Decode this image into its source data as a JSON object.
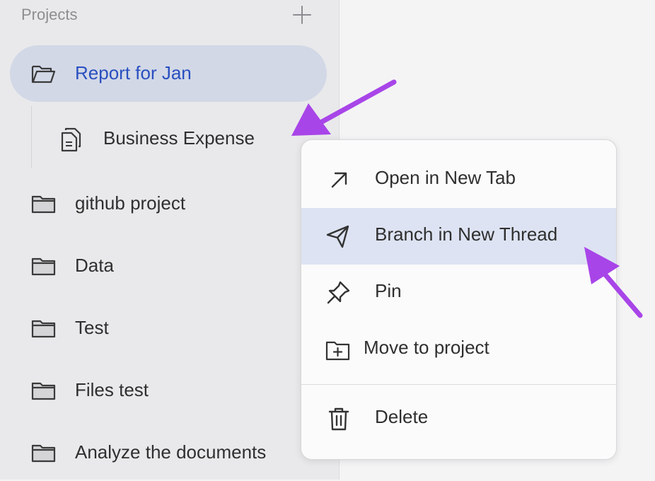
{
  "sidebar": {
    "section_title": "Projects",
    "add_icon": "plus-icon",
    "active_project": {
      "label": "Report for Jan",
      "icon": "folder-open-icon",
      "threads": [
        {
          "label": "Business Expense",
          "icon": "document-icon"
        }
      ]
    },
    "projects": [
      {
        "label": "github project",
        "icon": "folder-icon"
      },
      {
        "label": "Data",
        "icon": "folder-icon"
      },
      {
        "label": "Test",
        "icon": "folder-icon"
      },
      {
        "label": "Files test",
        "icon": "folder-icon"
      },
      {
        "label": "Analyze the documents",
        "icon": "folder-icon"
      }
    ]
  },
  "context_menu": {
    "items": [
      {
        "label": "Open in New Tab",
        "icon": "arrow-up-right-icon"
      },
      {
        "label": "Branch in New Thread",
        "icon": "send-icon",
        "highlighted": true
      },
      {
        "label": "Pin",
        "icon": "pin-icon"
      },
      {
        "label": "Move to project",
        "icon": "folder-plus-icon"
      },
      {
        "label": "Delete",
        "icon": "trash-icon"
      }
    ]
  },
  "colors": {
    "sidebar_bg": "#e9e9eb",
    "active_row_bg": "#d2d8e6",
    "active_text": "#2a4fc0",
    "menu_highlight_bg": "#dde3f2",
    "annotation_arrow": "#a845e8"
  }
}
